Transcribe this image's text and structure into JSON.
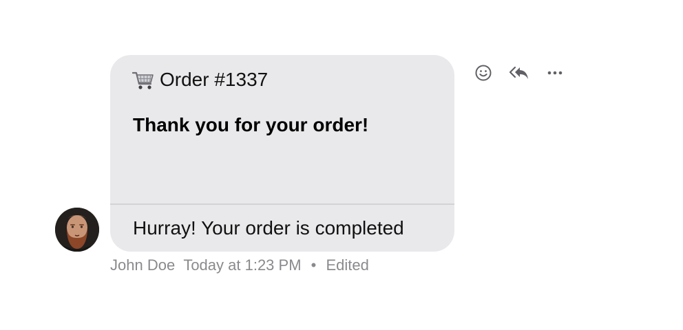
{
  "message": {
    "order_title": "Order #1337",
    "heading": "Thank you for your order!",
    "footer_text": "Hurray! Your order is completed",
    "icon": "shopping-cart-icon"
  },
  "meta": {
    "author": "John Doe",
    "timestamp": "Today at 1:23 PM",
    "separator": "•",
    "edited_label": "Edited"
  },
  "actions": [
    {
      "icon": "emoji-reaction-icon"
    },
    {
      "icon": "reply-all-icon"
    },
    {
      "icon": "more-options-icon"
    }
  ],
  "colors": {
    "bubble_background": "#e9e9eb",
    "divider": "#d2d2d7",
    "meta_text": "#8a8a8e",
    "action_icon": "#606066"
  }
}
